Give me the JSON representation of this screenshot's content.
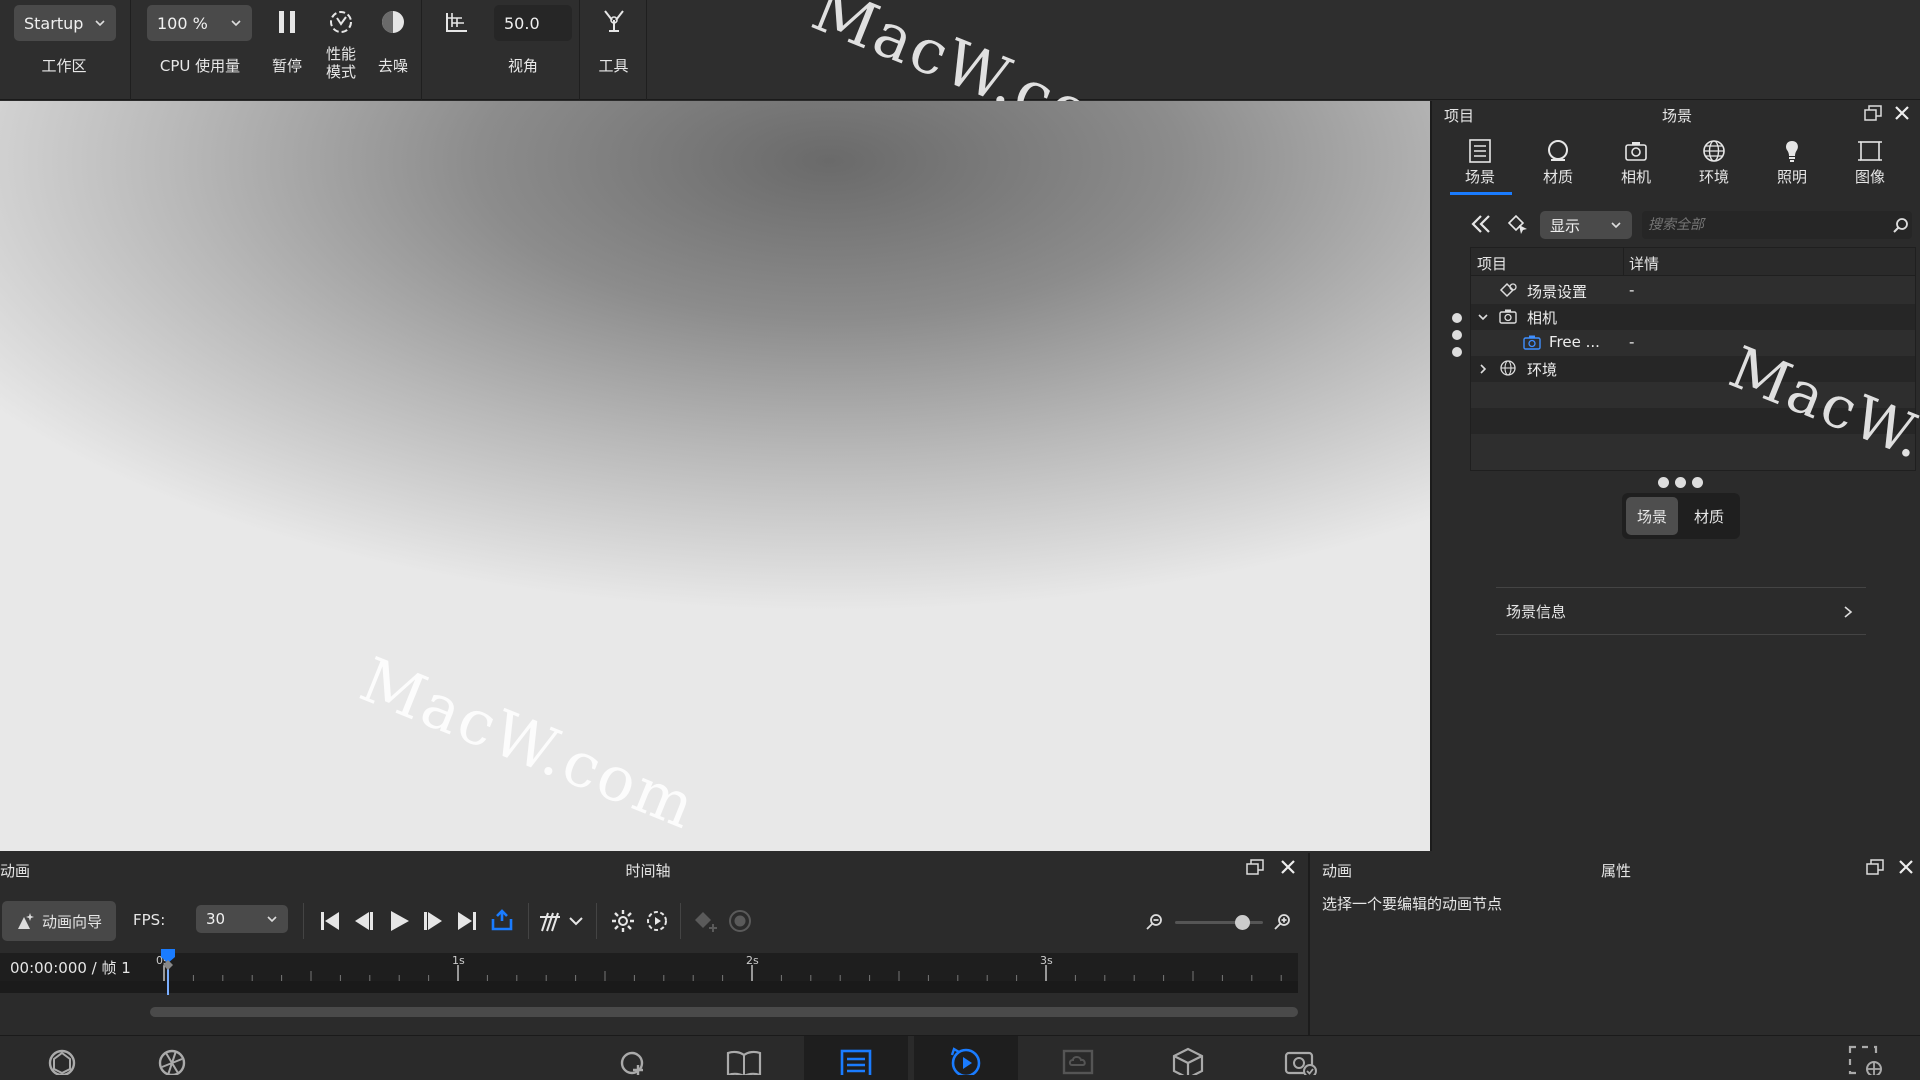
{
  "toolbar": {
    "workspace": {
      "value": "Startup",
      "label": "工作区"
    },
    "cpu": {
      "value": "100 %",
      "label": "CPU 使用量"
    },
    "pause_label": "暂停",
    "perf_label_1": "性能",
    "perf_label_2": "模式",
    "denoise_label": "去噪",
    "fov": {
      "value": "50.0",
      "label": "视角"
    },
    "tools_label": "工具"
  },
  "watermarks": [
    "MacW.com",
    "MacW.com",
    "MacW.c"
  ],
  "right_panel": {
    "left_title": "项目",
    "center_title": "场景",
    "tabs": [
      {
        "label": "场景",
        "icon": "list-icon",
        "active": true
      },
      {
        "label": "材质",
        "icon": "material-icon"
      },
      {
        "label": "相机",
        "icon": "camera-icon"
      },
      {
        "label": "环境",
        "icon": "globe-icon"
      },
      {
        "label": "照明",
        "icon": "bulb-icon"
      },
      {
        "label": "图像",
        "icon": "image-frame-icon"
      }
    ],
    "filter_value": "显示",
    "search_placeholder": "搜索全部",
    "columns": [
      "项目",
      "详情"
    ],
    "rows": [
      {
        "label": "场景设置",
        "detail": "-",
        "icon": "scene-settings-icon"
      },
      {
        "label": "相机",
        "detail": "",
        "icon": "camera-icon",
        "expanded": true
      },
      {
        "label": "Free ...",
        "detail": "-",
        "icon": "camera-icon"
      },
      {
        "label": "环境",
        "detail": "",
        "icon": "globe-icon",
        "expanded": false
      }
    ],
    "segment": [
      "场景",
      "材质"
    ],
    "scene_info": "场景信息"
  },
  "timeline": {
    "left_title": "动画",
    "center_title": "时间轴",
    "wizard_label": "动画向导",
    "fps_label": "FPS:",
    "fps_value": "30",
    "timecode": "00:00:000 / 帧 1",
    "ticks": [
      "0s",
      "1s",
      "2s",
      "3s"
    ]
  },
  "attributes": {
    "left_title": "动画",
    "center_title": "属性",
    "message": "选择一个要编辑的动画节点"
  },
  "colors": {
    "accent": "#1a7cff",
    "panel": "#2b2b2b",
    "toolbar": "#2e2e2e"
  }
}
